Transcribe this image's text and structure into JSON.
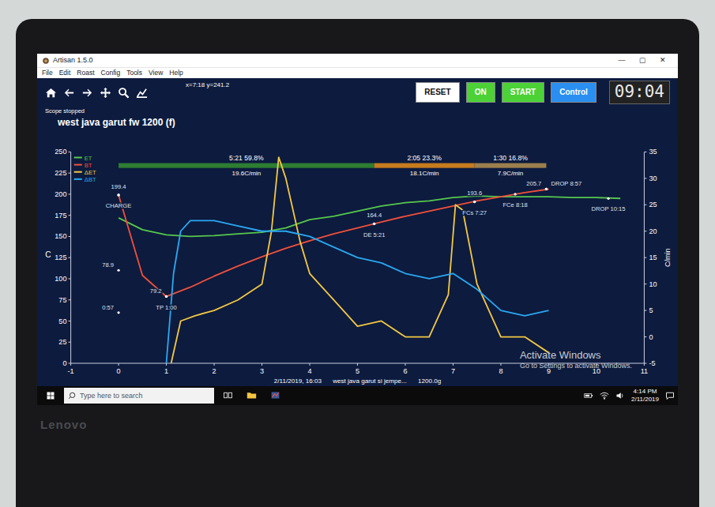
{
  "window": {
    "title": "Artisan 1.5.0",
    "controls": [
      "—",
      "▢",
      "✕"
    ]
  },
  "menu": [
    "File",
    "Edit",
    "Roast",
    "Config",
    "Tools",
    "View",
    "Help"
  ],
  "toolbar": {
    "coords": "x=7:18 y=241.2",
    "buttons": [
      {
        "label": "RESET",
        "color": "#ffffff"
      },
      {
        "label": "ON",
        "color": "#4cd137"
      },
      {
        "label": "START",
        "color": "#4cd137"
      },
      {
        "label": "Control",
        "color": "#2a8ff0"
      }
    ],
    "lcd": "09:04"
  },
  "status": "Scope stopped",
  "chart": {
    "title": "west java garut fw 1200 (f)",
    "y_left": {
      "label": "C",
      "ticks": [
        "0",
        "25",
        "50",
        "75",
        "100",
        "125",
        "150",
        "175",
        "200",
        "225",
        "250"
      ]
    },
    "y_right": {
      "label": "C/min",
      "ticks": [
        "-5",
        "0",
        "5",
        "10",
        "15",
        "20",
        "25",
        "30",
        "35"
      ]
    },
    "x_axis": {
      "ticks": [
        "-1",
        "0",
        "1",
        "2",
        "3",
        "4",
        "5",
        "6",
        "7",
        "8",
        "9",
        "10",
        "11"
      ]
    },
    "series": [
      {
        "label": "ET",
        "color": "#57c84d",
        "axis": "left",
        "times": [
          0,
          0.5,
          1,
          1.5,
          2,
          2.5,
          3,
          3.5,
          4,
          4.5,
          5,
          5.5,
          6,
          6.5,
          7,
          7.5,
          8,
          8.5,
          9,
          9.5,
          10,
          10.5
        ],
        "values": [
          172,
          158,
          152,
          150,
          151,
          153,
          155,
          160,
          170,
          174,
          180,
          186,
          190,
          192,
          196,
          198,
          197,
          197,
          197,
          196,
          196,
          195
        ]
      },
      {
        "label": "BT",
        "color": "#f0503c",
        "axis": "left",
        "times": [
          0,
          0.5,
          1,
          1.5,
          2,
          2.5,
          3,
          3.5,
          4,
          4.5,
          5,
          5.5,
          6,
          6.5,
          7,
          7.5,
          8,
          8.5,
          9
        ],
        "values": [
          199,
          104,
          79,
          90,
          103,
          115,
          126,
          136,
          145,
          153,
          160,
          167,
          174,
          180,
          186,
          192,
          197,
          202,
          206
        ]
      },
      {
        "label": "ΔET",
        "color": "#f2c744",
        "axis": "right",
        "times": [
          1.1,
          1.3,
          1.6,
          2,
          2.5,
          3,
          3.2,
          3.35,
          3.5,
          3.8,
          4,
          4.5,
          5,
          5.5,
          6,
          6.5,
          6.9,
          7.05,
          7.2,
          7.5,
          8,
          8.5,
          9
        ],
        "values": [
          -5,
          3,
          4,
          5,
          7,
          10,
          20,
          34,
          30,
          18,
          12,
          7,
          2,
          3,
          0,
          0,
          8,
          25,
          24,
          10,
          0,
          0,
          -3
        ]
      },
      {
        "label": "ΔBT",
        "color": "#2aa8f2",
        "axis": "right",
        "times": [
          1.0,
          1.15,
          1.3,
          1.5,
          2,
          2.5,
          3,
          3.5,
          4,
          4.5,
          5,
          5.5,
          6,
          6.5,
          7,
          7.5,
          8,
          8.5,
          9
        ],
        "values": [
          -5,
          12,
          20,
          22,
          22,
          21,
          20,
          20,
          19,
          17,
          15,
          14,
          12,
          11,
          12,
          9,
          5,
          4,
          5
        ]
      }
    ],
    "phases": [
      {
        "label": "5:21  59.8%",
        "rate": "19.6C/min",
        "start": 0,
        "end": 5.35,
        "color": "#2e7d32"
      },
      {
        "label": "2:05  23.3%",
        "rate": "18.1C/min",
        "start": 5.35,
        "end": 7.45,
        "color": "#c67b1e"
      },
      {
        "label": "1:30  16.8%",
        "rate": "7.9C/min",
        "start": 7.45,
        "end": 8.95,
        "color": "#9c7f4d"
      }
    ],
    "annotations": [
      {
        "text": "199.4",
        "t": 0,
        "v": 199,
        "place": "above"
      },
      {
        "text": "CHARGE",
        "t": 0,
        "v": 199,
        "place": "below"
      },
      {
        "text": "78.9",
        "t": 0,
        "v": 110,
        "place": "left"
      },
      {
        "text": "0:57",
        "t": 0,
        "v": 60,
        "place": "left"
      },
      {
        "text": "79.2",
        "t": 1,
        "v": 79,
        "place": "left"
      },
      {
        "text": "TP 1:00",
        "t": 1,
        "v": 79,
        "place": "below"
      },
      {
        "text": "164.4",
        "t": 5.35,
        "v": 165,
        "place": "above"
      },
      {
        "text": "DE 5:21",
        "t": 5.35,
        "v": 165,
        "place": "below"
      },
      {
        "text": "193.6",
        "t": 7.45,
        "v": 191,
        "place": "above"
      },
      {
        "text": "FCs 7:27",
        "t": 7.45,
        "v": 191,
        "place": "below"
      },
      {
        "text": "FCe 8:18",
        "t": 8.3,
        "v": 200,
        "place": "below"
      },
      {
        "text": "205.7",
        "t": 8.95,
        "v": 206,
        "place": "left"
      },
      {
        "text": "DROP 8:57",
        "t": 8.95,
        "v": 206,
        "place": "right"
      },
      {
        "text": "DROP 10:15",
        "t": 10.25,
        "v": 195,
        "place": "below"
      }
    ],
    "footer": [
      "2/11/2019, 16:03",
      "west java garut si jempe...",
      "1200.0g"
    ]
  },
  "watermark": {
    "title": "Activate Windows",
    "text": "Go to Settings to activate Windows."
  },
  "taskbar": {
    "search": "Type here to search",
    "time": "4:14 PM",
    "date": "2/11/2019"
  },
  "brand": "Lenovo"
}
